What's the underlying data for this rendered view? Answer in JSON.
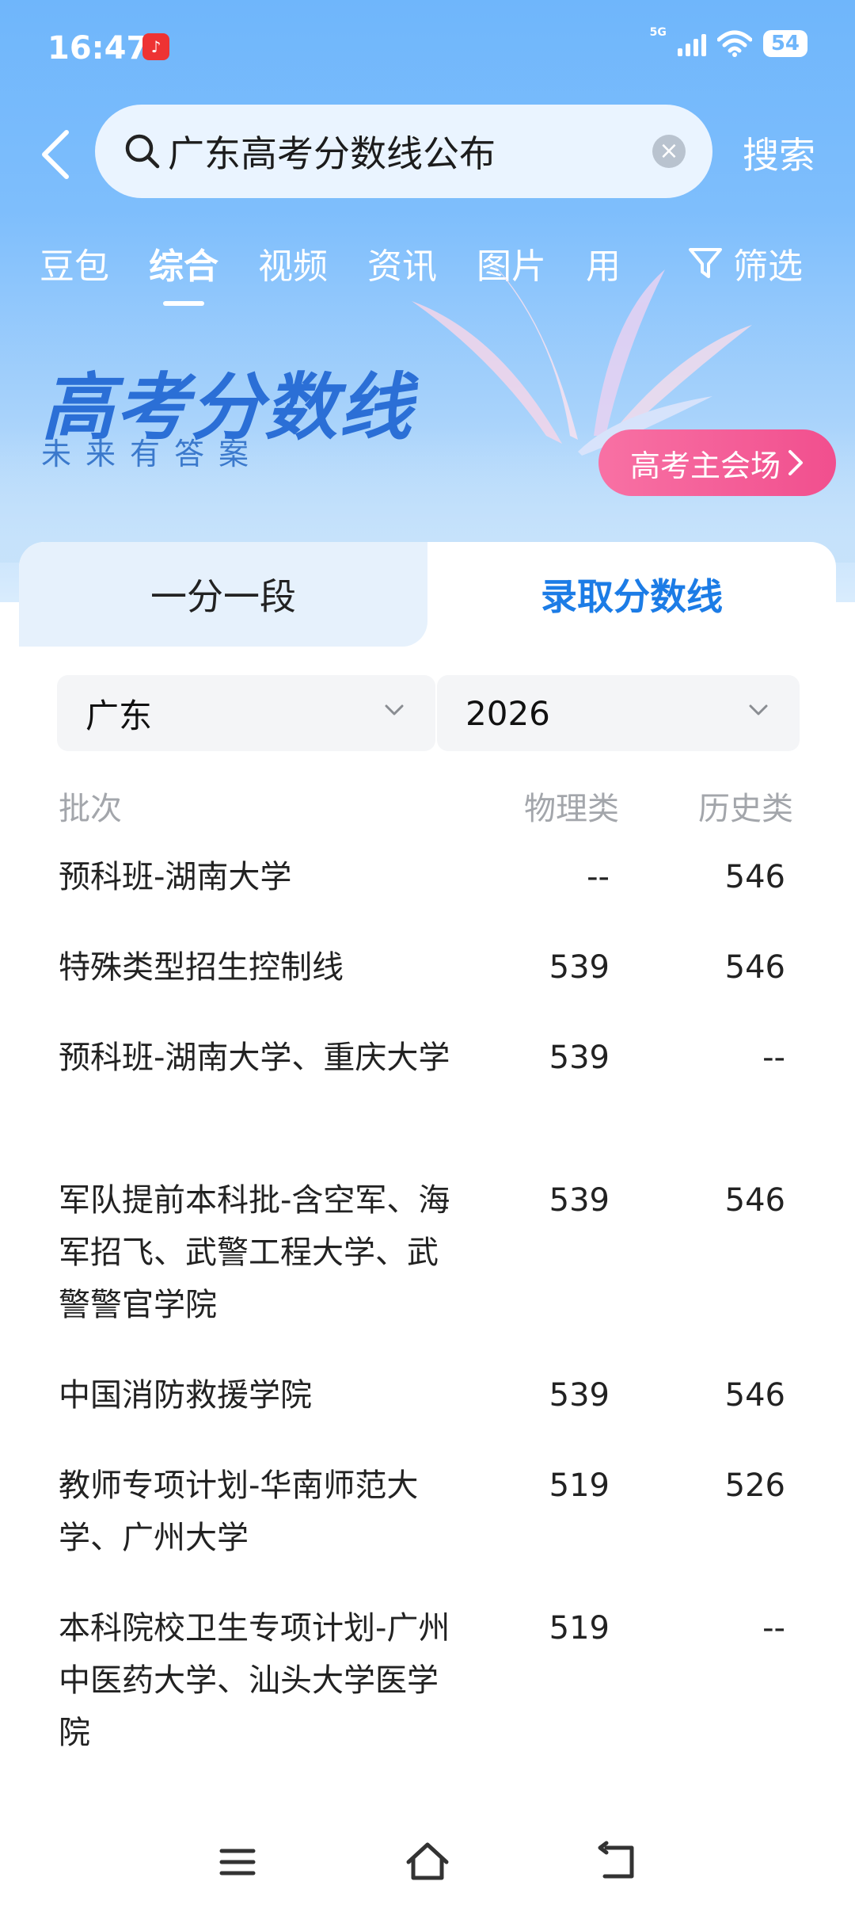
{
  "status_bar": {
    "time": "16:47",
    "network": "5G",
    "battery": "54"
  },
  "search": {
    "query": "广东高考分数线公布",
    "button_label": "搜索"
  },
  "tabs": [
    {
      "label": "豆包"
    },
    {
      "label": "综合"
    },
    {
      "label": "视频"
    },
    {
      "label": "资讯"
    },
    {
      "label": "图片"
    },
    {
      "label": "用"
    }
  ],
  "filter_label": "筛选",
  "banner": {
    "title": "高考分数线",
    "subtitle": "未来有答案",
    "button_label": "高考主会场",
    "button_color": "#f14f8e"
  },
  "card": {
    "tab_left": "一分一段",
    "tab_right": "录取分数线",
    "province": "广东",
    "year": "2026",
    "headers": {
      "batch": "批次",
      "physics": "物理类",
      "history": "历史类"
    },
    "rows": [
      {
        "name": "预科班-湖南大学",
        "physics": "--",
        "history": "546"
      },
      {
        "name": "特殊类型招生控制线",
        "physics": "539",
        "history": "546"
      },
      {
        "name": "预科班-湖南大学、重庆大学",
        "physics": "539",
        "history": "--"
      },
      {
        "name": "军队提前本科批-含空军、海军招飞、武警工程大学、武警警官学院",
        "physics": "539",
        "history": "546"
      },
      {
        "name": "中国消防救援学院",
        "physics": "539",
        "history": "546"
      },
      {
        "name": "教师专项计划-华南师范大学、广州大学",
        "physics": "519",
        "history": "526"
      },
      {
        "name": "本科院校卫生专项计划-广州中医药大学、汕头大学医学院",
        "physics": "519",
        "history": "--"
      }
    ]
  },
  "colors": {
    "accent": "#1c7ce6",
    "sky": "#6fb6fb"
  }
}
